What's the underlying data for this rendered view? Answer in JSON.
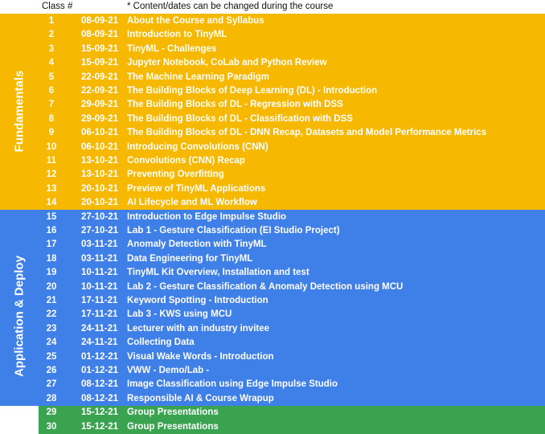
{
  "header": {
    "class_label": "Class #",
    "note": "* Content/dates can be changed during the course"
  },
  "sections": {
    "fundamentals": "Fundamentals",
    "application": "Application & Deploy"
  },
  "colors": {
    "fundamentals": "#f6b800",
    "application": "#3f7fe8",
    "presentations": "#39a350"
  },
  "classes": [
    {
      "num": "1",
      "date": "08-09-21",
      "title": "About the Course and Syllabus"
    },
    {
      "num": "2",
      "date": "08-09-21",
      "title": "Introduction to TinyML"
    },
    {
      "num": "3",
      "date": "15-09-21",
      "title": "TinyML - Challenges"
    },
    {
      "num": "4",
      "date": "15-09-21",
      "title": "Jupyter Notebook, CoLab and Python Review"
    },
    {
      "num": "5",
      "date": "22-09-21",
      "title": "The Machine Learning Paradigm"
    },
    {
      "num": "6",
      "date": "22-09-21",
      "title": "The Building Blocks of Deep Learning (DL) - Introduction"
    },
    {
      "num": "7",
      "date": "29-09-21",
      "title": "The Building Blocks of DL - Regression with DSS"
    },
    {
      "num": "8",
      "date": "29-09-21",
      "title": "The Building Blocks of DL - Classification with DSS"
    },
    {
      "num": "9",
      "date": "06-10-21",
      "title": "The Building Blocks of DL - DNN Recap, Datasets and Model Performance Metrics"
    },
    {
      "num": "10",
      "date": "06-10-21",
      "title": "Introducing Convolutions (CNN)"
    },
    {
      "num": "11",
      "date": "13-10-21",
      "title": "Convolutions (CNN) Recap"
    },
    {
      "num": "12",
      "date": "13-10-21",
      "title": "Preventing Overfitting"
    },
    {
      "num": "13",
      "date": "20-10-21",
      "title": "Preview of TinyML Applications"
    },
    {
      "num": "14",
      "date": "20-10-21",
      "title": "AI Lifecycle and ML Workflow"
    },
    {
      "num": "15",
      "date": "27-10-21",
      "title": "Introduction to Edge Impulse Studio"
    },
    {
      "num": "16",
      "date": "27-10-21",
      "title": "Lab 1 - Gesture Classification (EI Studio Project)"
    },
    {
      "num": "17",
      "date": "03-11-21",
      "title": "Anomaly Detection with TinyML"
    },
    {
      "num": "18",
      "date": "03-11-21",
      "title": "Data Engineering for TinyML"
    },
    {
      "num": "19",
      "date": "10-11-21",
      "title": "TinyML Kit Overview, Installation and test"
    },
    {
      "num": "20",
      "date": "10-11-21",
      "title": "Lab 2 - Gesture Classification & Anomaly Detection using MCU"
    },
    {
      "num": "21",
      "date": "17-11-21",
      "title": "Keyword Spotting - Introduction"
    },
    {
      "num": "22",
      "date": "17-11-21",
      "title": "Lab 3 - KWS using MCU"
    },
    {
      "num": "23",
      "date": "24-11-21",
      "title": "Lecturer with an industry invitee"
    },
    {
      "num": "24",
      "date": "24-11-21",
      "title": "Collecting Data"
    },
    {
      "num": "25",
      "date": "01-12-21",
      "title": "Visual Wake Words - Introduction"
    },
    {
      "num": "26",
      "date": "01-12-21",
      "title": "VWW - Demo/Lab -"
    },
    {
      "num": "27",
      "date": "08-12-21",
      "title": "Image Classification using Edge Impulse Studio"
    },
    {
      "num": "28",
      "date": "08-12-21",
      "title": "Responsible AI & Course Wrapup"
    },
    {
      "num": "29",
      "date": "15-12-21",
      "title": "Group Presentations"
    },
    {
      "num": "30",
      "date": "15-12-21",
      "title": "Group Presentations"
    }
  ]
}
